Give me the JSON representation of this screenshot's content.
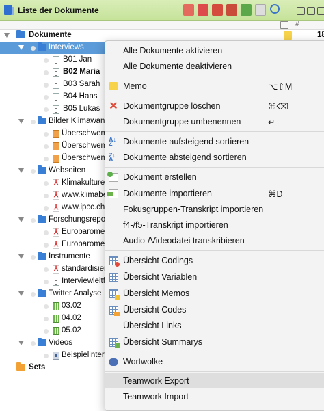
{
  "window": {
    "title": "Liste der Dokumente"
  },
  "tree": {
    "root": {
      "label": "Dokumente",
      "count": "18"
    },
    "groups": [
      {
        "label": "Interviews",
        "selected": true,
        "items": [
          "B01 Jan",
          "B02 Maria",
          "B03 Sarah",
          "B04 Hans",
          "B05 Lukas"
        ]
      },
      {
        "label": "Bilder Klimawand",
        "items": [
          "Überschwem",
          "Überschwem",
          "Überschwem"
        ]
      },
      {
        "label": "Webseiten",
        "items": [
          "Klimakulturen",
          "www.klimabe",
          "www.ipcc.ch"
        ]
      },
      {
        "label": "Forschungsreport",
        "items": [
          "Eurobarometer",
          "Eurobarometer"
        ]
      },
      {
        "label": "Instrumente",
        "items": [
          "standardisier",
          "Interviewleitfa"
        ]
      },
      {
        "label": "Twitter Analyse",
        "items": [
          "03.02",
          "04.02",
          "05.02"
        ]
      },
      {
        "label": "Videos",
        "items": [
          "Beispielinterv"
        ]
      }
    ],
    "sets": {
      "label": "Sets"
    }
  },
  "context_menu": {
    "items": [
      {
        "label": "Alle Dokumente aktivieren"
      },
      {
        "label": "Alle Dokumente deaktivieren"
      },
      {
        "label": "Memo",
        "shortcut": "⌥⇧M",
        "icon": "memo-icon"
      },
      {
        "label": "Dokumentgruppe löschen",
        "shortcut": "⌘⌫",
        "icon": "delete-x-icon"
      },
      {
        "label": "Dokumentgruppe umbenennen",
        "shortcut": "↵"
      },
      {
        "label": "Dokumente aufsteigend sortieren",
        "icon": "sort-ascending-icon"
      },
      {
        "label": "Dokumente absteigend sortieren",
        "icon": "sort-descending-icon"
      },
      {
        "label": "Dokument erstellen",
        "icon": "document-create-icon"
      },
      {
        "label": "Dokumente importieren",
        "shortcut": "⌘D",
        "icon": "document-import-icon"
      },
      {
        "label": "Fokusgruppen-Transkript importieren"
      },
      {
        "label": "f4-/f5-Transkript importieren"
      },
      {
        "label": "Audio-/Videodatei transkribieren"
      },
      {
        "label": "Übersicht Codings",
        "icon": "overview-codings-icon"
      },
      {
        "label": "Übersicht Variablen",
        "icon": "overview-variables-icon"
      },
      {
        "label": "Übersicht Memos",
        "icon": "overview-memos-icon"
      },
      {
        "label": "Übersicht Codes",
        "icon": "overview-codes-icon"
      },
      {
        "label": "Übersicht Links"
      },
      {
        "label": "Übersicht Summarys",
        "icon": "overview-summarys-icon"
      },
      {
        "label": "Wortwolke",
        "icon": "word-cloud-icon"
      },
      {
        "label": "Teamwork Export",
        "hover": true
      },
      {
        "label": "Teamwork Import"
      }
    ]
  },
  "colors": {
    "titlebar": "#c6e39a",
    "selection": "#5b9bd9",
    "folder": "#3a7fd6",
    "sets_folder": "#f2a234",
    "memo": "#f7d34a"
  }
}
